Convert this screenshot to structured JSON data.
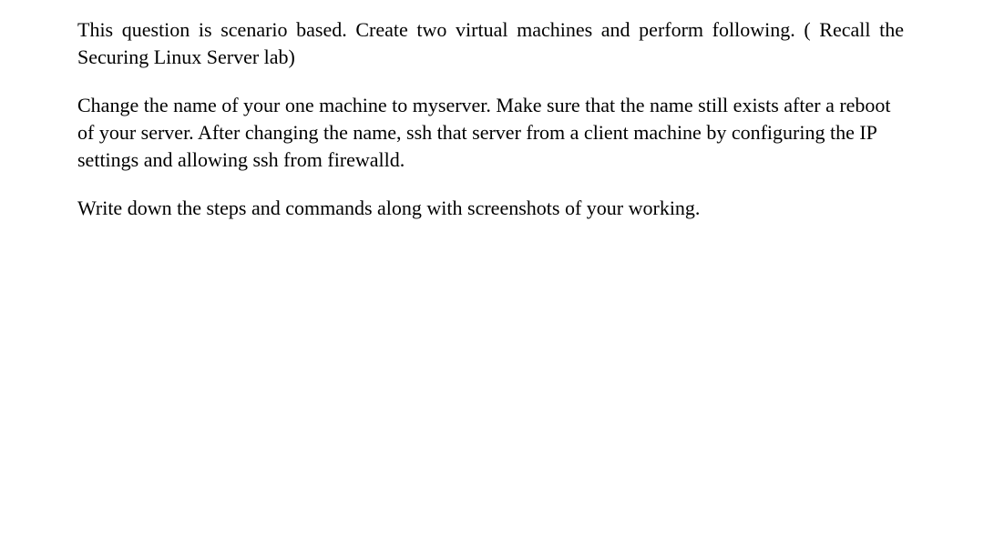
{
  "document": {
    "paragraphs": {
      "p1": "This question is scenario based. Create two virtual machines and perform following. ( Recall the Securing Linux Server lab)",
      "p2": "Change the name of your one machine to myserver. Make sure that the name still exists after a reboot of your server. After changing the name, ssh that server from a client machine by configuring the IP settings and allowing ssh from firewalld.",
      "p3": "Write down the steps and commands  along with screenshots of your working."
    }
  }
}
